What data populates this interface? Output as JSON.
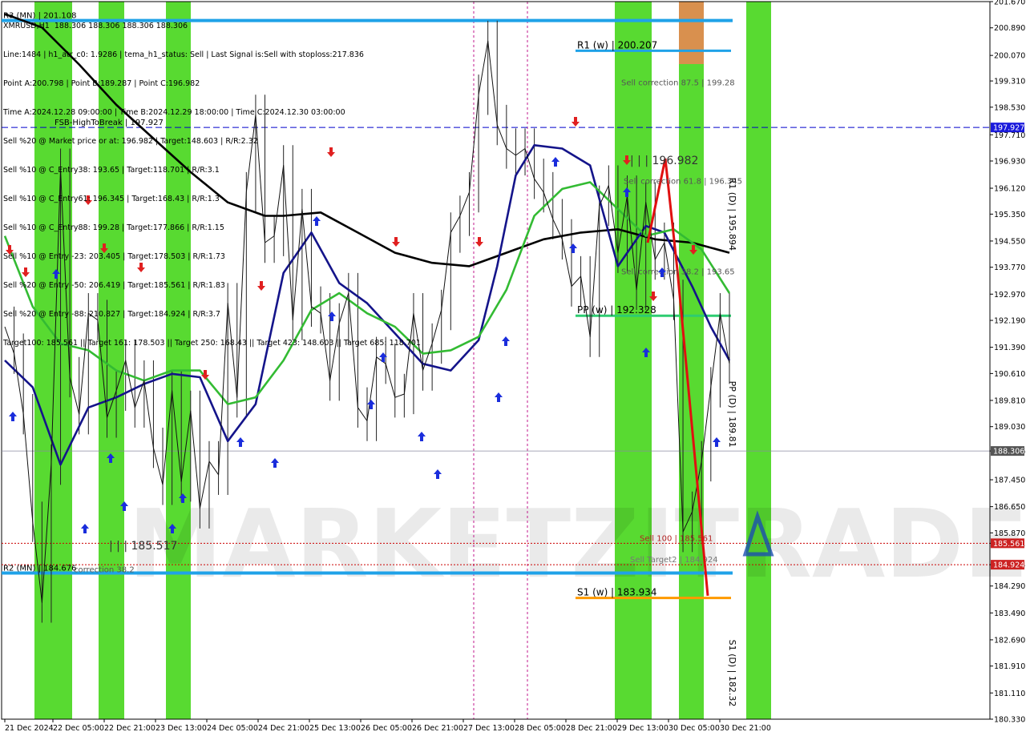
{
  "info_lines": [
    "XMRUSD,H1  188.306 188.306 188.306 188.306",
    "Line:1484 | h1_atr_c0: 1.9286 | tema_h1_status: Sell | Last Signal is:Sell with stoploss:217.836",
    "Point A:200.798 | Point B:189.287 | Point C:196.982",
    "Time A:2024.12.28 09:00:00 | Time B:2024.12.29 18:00:00 | Time C:2024.12.30 03:00:00",
    "Sell %20 @ Market price or at: 196.982 | Target:148.603 | R/R:2.32",
    "Sell %10 @ C_Entry38: 193.65 | Target:118.701 | R/R:3.1",
    "Sell %10 @ C_Entry61: 196.345 | Target:168.43 | R/R:1.3",
    "Sell %10 @ C_Entry88: 199.28 | Target:177.866 | R/R:1.15",
    "Sell %10 @ Entry -23: 203.405 | Target:178.503 | R/R:1.73",
    "Sell %20 @ Entry -50: 206.419 | Target:185.561 | R/R:1.83",
    "Sell %20 @ Entry -88: 210.827 | Target:184.924 | R/R:3.7",
    "Target100: 185.561 || Target 161: 178.503 || Target 250: 168.43 || Target 423: 148.603 || Target 685: 118.701"
  ],
  "watermark": "MARKETZITRADE",
  "chart_data": {
    "type": "line",
    "symbol": "XMRUSD,H1",
    "ylim": [
      180.33,
      201.67
    ],
    "y_ticks": [
      "201.670",
      "200.890",
      "200.070",
      "199.310",
      "198.530",
      "197.710",
      "196.930",
      "196.120",
      "195.350",
      "194.550",
      "193.770",
      "192.970",
      "192.190",
      "191.390",
      "190.610",
      "189.810",
      "189.030",
      "188.306",
      "187.450",
      "186.650",
      "185.870",
      "185.561",
      "184.924",
      "184.290",
      "183.490",
      "182.690",
      "181.910",
      "181.110",
      "180.330"
    ],
    "x_ticks": [
      "21 Dec 2024",
      "22 Dec 05:00",
      "22 Dec 21:00",
      "23 Dec 13:00",
      "24 Dec 05:00",
      "24 Dec 21:00",
      "25 Dec 13:00",
      "26 Dec 05:00",
      "26 Dec 21:00",
      "27 Dec 13:00",
      "28 Dec 05:00",
      "28 Dec 21:00",
      "29 Dec 13:00",
      "30 Dec 05:00",
      "30 Dec 21:00"
    ],
    "current_price": 188.306,
    "horizontal_levels": [
      {
        "label": "R3 (MN) | 201.108",
        "value": 201.108,
        "color": "#1fa2e8"
      },
      {
        "label": "R1 (w) | 200.207",
        "value": 200.207,
        "color": "#1fa2e8"
      },
      {
        "label": "FSB-HighToBreak | 197.927",
        "value": 197.927,
        "color": "#0000cc"
      },
      {
        "label": "PP (w) | 192.328",
        "value": 192.328,
        "color": "#2ecc71"
      },
      {
        "label": "Sell 100 | 185.561",
        "value": 185.561,
        "color": "#cc0000"
      },
      {
        "label": "Sell Target2 | 184.924",
        "value": 184.924,
        "color": "#cc0000"
      },
      {
        "label": "R2 (MN) | 184.676",
        "value": 184.676,
        "color": "#1fa2e8"
      },
      {
        "label": "S1 (w) | 183.934",
        "value": 183.934,
        "color": "#ff9900"
      }
    ],
    "annotations": [
      {
        "text": "Sell correction 87.5 | 199.28",
        "value": 199.28
      },
      {
        "text": "| | | 196.982",
        "value": 196.982
      },
      {
        "text": "Sell correction 61.8 | 196.345",
        "value": 196.345
      },
      {
        "text": "Sell correction 38.2 | 193.65",
        "value": 193.65
      },
      {
        "text": "correction 38.2",
        "value": 184.8
      },
      {
        "text": "| | | 185.517",
        "value": 185.517
      }
    ],
    "vertical_labels": [
      "R1 (D) | 195.894",
      "PP (D) | 189.81",
      "S1 (D) | 182.32"
    ],
    "price_badges": [
      {
        "text": "197.927",
        "value": 197.927,
        "color": "#1a1adc"
      },
      {
        "text": "188.306",
        "value": 188.306,
        "color": "#555555"
      },
      {
        "text": "185.561",
        "value": 185.561,
        "color": "#cc2222"
      },
      {
        "text": "184.924",
        "value": 184.924,
        "color": "#cc2222"
      }
    ],
    "series": [
      {
        "name": "MA slow",
        "color": "#000000",
        "x": [
          0,
          4,
          8,
          12,
          16,
          20,
          24,
          28,
          30,
          34,
          38,
          42,
          46,
          50,
          54,
          58,
          62,
          66,
          70,
          74,
          78
        ],
        "values": [
          201.3,
          200.9,
          199.8,
          198.6,
          197.6,
          196.6,
          195.7,
          195.3,
          195.3,
          195.4,
          194.8,
          194.2,
          193.9,
          193.8,
          194.2,
          194.6,
          194.8,
          194.9,
          194.6,
          194.5,
          194.2
        ]
      },
      {
        "name": "MA fast",
        "color": "#14148a",
        "x": [
          0,
          3,
          6,
          9,
          12,
          15,
          18,
          21,
          24,
          27,
          30,
          33,
          36,
          39,
          42,
          45,
          48,
          51,
          53,
          55,
          57,
          60,
          63,
          66,
          69,
          71,
          74,
          76,
          78
        ],
        "values": [
          191.0,
          190.2,
          187.9,
          189.6,
          189.9,
          190.3,
          190.6,
          190.5,
          188.6,
          189.7,
          193.6,
          194.8,
          193.3,
          192.7,
          191.8,
          190.9,
          190.7,
          191.6,
          193.8,
          196.5,
          197.4,
          197.3,
          196.8,
          193.8,
          195.0,
          194.8,
          193.2,
          192.0,
          191.0
        ]
      },
      {
        "name": "MA mid",
        "color": "#33bb33",
        "x": [
          0,
          3,
          6,
          9,
          12,
          15,
          18,
          21,
          24,
          27,
          30,
          33,
          36,
          39,
          42,
          45,
          48,
          51,
          54,
          57,
          60,
          63,
          66,
          69,
          72,
          75,
          78
        ],
        "values": [
          194.7,
          192.6,
          191.5,
          191.3,
          190.7,
          190.4,
          190.7,
          190.7,
          189.7,
          189.9,
          191.0,
          192.5,
          193.0,
          192.4,
          192.0,
          191.2,
          191.3,
          191.7,
          193.1,
          195.3,
          196.1,
          196.3,
          195.5,
          194.7,
          194.9,
          194.3,
          193.0
        ]
      },
      {
        "name": "Price",
        "color": "#111111",
        "x": [
          0,
          1,
          2,
          3,
          4,
          5,
          6,
          7,
          8,
          9,
          10,
          11,
          12,
          13,
          14,
          15,
          16,
          17,
          18,
          19,
          20,
          21,
          22,
          23,
          24,
          25,
          26,
          27,
          28,
          29,
          30,
          31,
          32,
          33,
          34,
          35,
          36,
          37,
          38,
          39,
          40,
          41,
          42,
          43,
          44,
          45,
          46,
          47,
          48,
          49,
          50,
          51,
          52,
          53,
          54,
          55,
          56,
          57,
          58,
          59,
          60,
          61,
          62,
          63,
          64,
          65,
          66,
          67,
          68,
          69,
          70,
          71,
          72,
          73,
          74,
          75,
          76,
          77,
          78
        ],
        "values": [
          192.0,
          191.2,
          189.4,
          186.2,
          183.8,
          187.9,
          196.7,
          190.5,
          189.4,
          192.4,
          192.2,
          189.3,
          190.1,
          191.0,
          189.6,
          190.4,
          188.4,
          187.3,
          190.1,
          187.4,
          189.5,
          186.6,
          188.0,
          187.6,
          192.7,
          189.9,
          196.0,
          198.3,
          194.5,
          194.7,
          196.8,
          192.2,
          195.5,
          192.6,
          192.4,
          190.4,
          192.1,
          193.0,
          189.6,
          189.2,
          191.1,
          190.9,
          189.9,
          190.0,
          192.4,
          190.7,
          191.5,
          192.5,
          194.8,
          195.3,
          196.0,
          198.9,
          200.5,
          198.0,
          197.3,
          197.1,
          197.3,
          196.4,
          196.0,
          195.2,
          194.6,
          193.2,
          193.5,
          191.7,
          195.6,
          196.2,
          194.2,
          195.9,
          193.1,
          195.7,
          194.0,
          194.5,
          192.8,
          185.9,
          186.5,
          188.0,
          190.2,
          192.4,
          190.9
        ]
      }
    ],
    "green_bands": [
      [
        43,
        90
      ],
      [
        123,
        155
      ],
      [
        207,
        238
      ],
      [
        767,
        813
      ],
      [
        847,
        878
      ],
      [
        931,
        962
      ]
    ],
    "orange_band": [
      847,
      878
    ],
    "grid": false
  }
}
